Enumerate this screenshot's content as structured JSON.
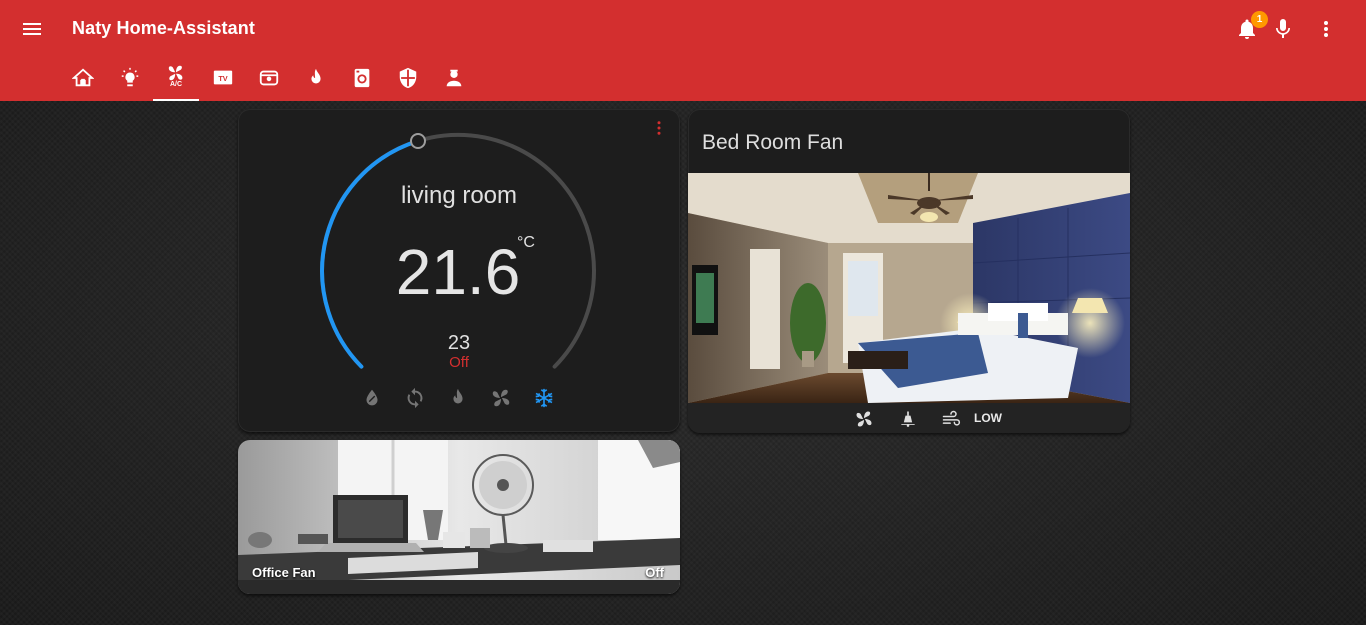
{
  "app": {
    "title": "Naty Home-Assistant",
    "notification_count": "1",
    "accent_color": "#d32f2f",
    "badge_color": "#ff9800"
  },
  "tabs": [
    {
      "icon": "home-icon"
    },
    {
      "icon": "lightbulb-icon"
    },
    {
      "icon": "fan-icon",
      "label": "A/C",
      "active": true
    },
    {
      "icon": "tv-icon"
    },
    {
      "icon": "camera-icon"
    },
    {
      "icon": "fire-icon"
    },
    {
      "icon": "washing-machine-icon"
    },
    {
      "icon": "shield-icon"
    },
    {
      "icon": "person-icon"
    }
  ],
  "thermostat": {
    "name": "living room",
    "current_temp": "21.6",
    "unit": "°C",
    "target_temp": "23",
    "state": "Off",
    "state_color": "#d32f2f",
    "modes": [
      "dry-icon",
      "auto-icon",
      "heat-icon",
      "fan-icon",
      "cool-icon"
    ],
    "active_mode": "cool-icon",
    "active_color": "#2196f3"
  },
  "bedroom_fan": {
    "title": "Bed Room Fan",
    "speed": "LOW"
  },
  "office_fan": {
    "name": "Office Fan",
    "state": "Off"
  }
}
